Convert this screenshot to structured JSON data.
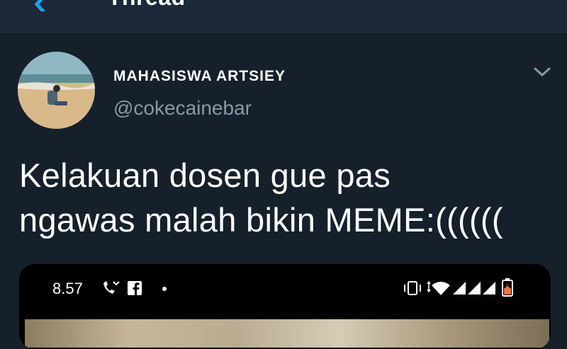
{
  "topbar": {
    "title": "Thread"
  },
  "tweet": {
    "display_name": "MAHASISWA ARTSIEY",
    "handle": "@cokecainebar",
    "text_lines": [
      "Kelakuan dosen gue pas",
      "ngawas malah bikin MEME:(((((("
    ]
  },
  "media": {
    "status_bar": {
      "time": "8.57"
    },
    "icons": [
      "phone-missed-icon",
      "facebook-icon",
      "vibrate-icon",
      "wifi-icon",
      "signal-icon",
      "battery-icon"
    ]
  },
  "colors": {
    "background": "#15202b",
    "header": "#1c2938",
    "accent": "#1da1f2",
    "muted": "#8899a6"
  }
}
